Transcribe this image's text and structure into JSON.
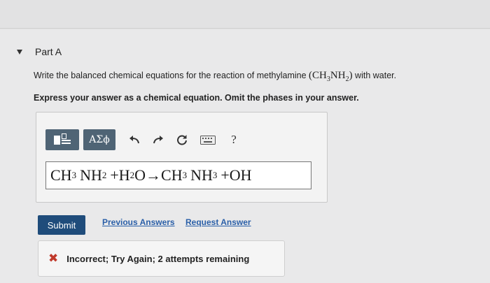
{
  "part": {
    "title": "Part A"
  },
  "question": {
    "prefix": "Write the balanced chemical equations for the reaction of methylamine ",
    "formula": {
      "open": "(CH",
      "sub1": "3",
      "mid": "NH",
      "sub2": "2",
      "close": ")"
    },
    "suffix": " with water."
  },
  "instruction": "Express your answer as a chemical equation. Omit the phases in your answer.",
  "toolbar": {
    "greek_label": "ΑΣϕ",
    "help_label": "?",
    "icons": [
      "templates-icon",
      "undo-icon",
      "redo-icon",
      "reset-icon",
      "keyboard-icon",
      "help-icon"
    ]
  },
  "answer": {
    "t1": "CH",
    "s1": "3",
    "t2": "NH",
    "s2": "2",
    "t3": "+H",
    "s3": "2",
    "t4": "O→CH",
    "s4": "3",
    "t5": "NH",
    "s5": "3",
    "t6": "+OH"
  },
  "buttons": {
    "submit": "Submit",
    "previous_answers": "Previous Answers",
    "request_answer": "Request Answer"
  },
  "feedback": {
    "icon": "✖",
    "text": "Incorrect; Try Again; 2 attempts remaining",
    "icon_color": "#c0392b"
  },
  "colors": {
    "toolbar_button": "#4f6475",
    "submit": "#1f4c7b",
    "link": "#2a5fa8"
  }
}
